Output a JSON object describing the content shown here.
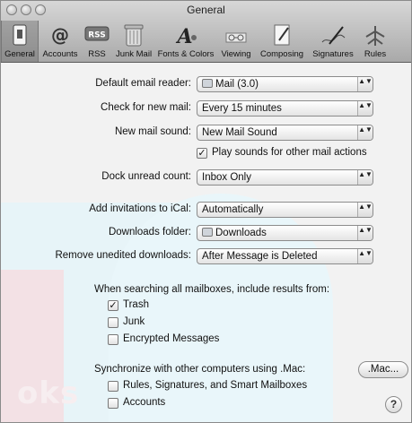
{
  "window": {
    "title": "General"
  },
  "toolbar": {
    "items": [
      {
        "label": "General",
        "icon": "general-switch-icon"
      },
      {
        "label": "Accounts",
        "icon": "at-sign-icon"
      },
      {
        "label": "RSS",
        "icon": "rss-icon"
      },
      {
        "label": "Junk Mail",
        "icon": "trash-can-icon"
      },
      {
        "label": "Fonts & Colors",
        "icon": "fonts-icon"
      },
      {
        "label": "Viewing",
        "icon": "viewing-glasses-icon"
      },
      {
        "label": "Composing",
        "icon": "pencil-paper-icon"
      },
      {
        "label": "Signatures",
        "icon": "signature-pen-icon"
      },
      {
        "label": "Rules",
        "icon": "rules-icon"
      }
    ]
  },
  "settings": {
    "default_email_reader": {
      "label": "Default email reader:",
      "value": "Mail (3.0)"
    },
    "check_new_mail": {
      "label": "Check for new mail:",
      "value": "Every 15 minutes"
    },
    "new_mail_sound": {
      "label": "New mail sound:",
      "value": "New Mail Sound"
    },
    "play_sounds": {
      "label": "Play sounds for other mail actions",
      "checked": true
    },
    "dock_unread": {
      "label": "Dock unread count:",
      "value": "Inbox Only"
    },
    "add_invitations": {
      "label": "Add invitations to iCal:",
      "value": "Automatically"
    },
    "downloads_folder": {
      "label": "Downloads folder:",
      "value": "Downloads"
    },
    "remove_unedited": {
      "label": "Remove unedited downloads:",
      "value": "After Message is Deleted"
    }
  },
  "search": {
    "heading": "When searching all mailboxes, include results from:",
    "options": [
      {
        "label": "Trash",
        "checked": true
      },
      {
        "label": "Junk",
        "checked": false
      },
      {
        "label": "Encrypted Messages",
        "checked": false
      }
    ]
  },
  "sync": {
    "heading": "Synchronize with other computers using .Mac:",
    "button": ".Mac...",
    "options": [
      {
        "label": "Rules, Signatures, and Smart Mailboxes",
        "checked": false
      },
      {
        "label": "Accounts",
        "checked": false
      }
    ]
  },
  "help_label": "?",
  "watermark": "oks",
  "check_glyph": "✓",
  "arrows_glyph": "▲▼"
}
